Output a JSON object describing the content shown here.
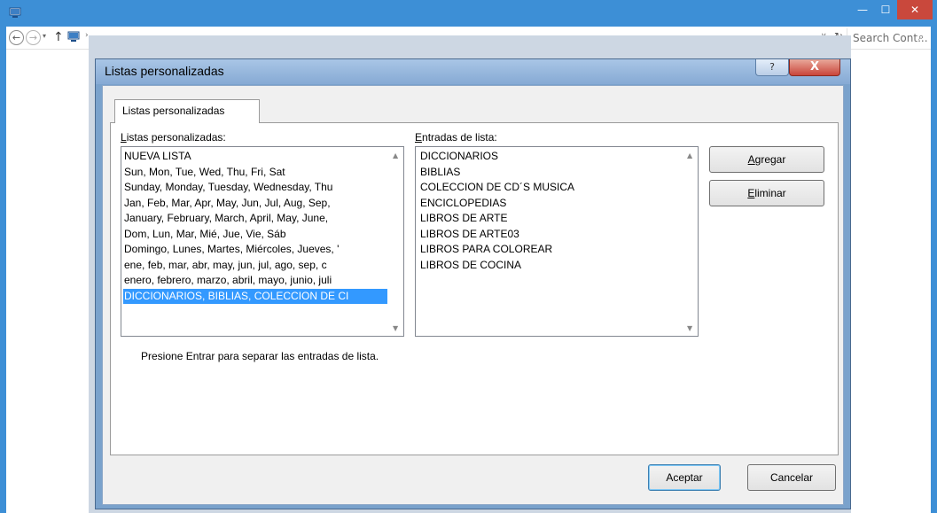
{
  "window": {
    "min_glyph": "—",
    "max_glyph": "☐",
    "close_glyph": "✕"
  },
  "navbar": {
    "back_glyph": "←",
    "forward_glyph": "→",
    "recent_glyph": "▾",
    "up_glyph": "↑",
    "sep_glyph": "›",
    "dropdown_glyph": "∨",
    "refresh_glyph": "↻",
    "search_placeholder": "Search Cont...",
    "search_glyph": "⌕"
  },
  "dialog": {
    "title": "Listas personalizadas",
    "help_glyph": "?",
    "close_glyph": "X",
    "tab_label": "Listas personalizadas",
    "custom_lists_label_first": "L",
    "custom_lists_label_rest": "istas personalizadas:",
    "custom_lists": [
      "NUEVA LISTA",
      "Sun, Mon, Tue, Wed, Thu, Fri, Sat",
      "Sunday, Monday, Tuesday, Wednesday, Thu",
      "Jan, Feb, Mar, Apr, May, Jun, Jul, Aug, Sep,",
      "January, February, March, April, May, June,",
      "Dom, Lun, Mar, Mié, Jue, Vie, Sáb",
      "Domingo, Lunes, Martes, Miércoles, Jueves, '",
      "ene, feb, mar, abr, may, jun, jul, ago, sep, c",
      "enero, febrero, marzo, abril, mayo, junio, juli",
      "DICCIONARIOS, BIBLIAS, COLECCION DE CI"
    ],
    "selected_index": 9,
    "entries_label_first": "E",
    "entries_label_rest": "ntradas de lista:",
    "entries": [
      "DICCIONARIOS",
      "BIBLIAS",
      "COLECCION DE CD´S MUSICA",
      "ENCICLOPEDIAS",
      "LIBROS DE ARTE",
      "LIBROS DE ARTE03",
      "LIBROS PARA COLOREAR",
      "LIBROS DE COCINA"
    ],
    "add_button_first": "A",
    "add_button_rest": "gregar",
    "delete_button_first": "E",
    "delete_button_rest": "liminar",
    "hint": "Presione Entrar para separar las entradas de lista.",
    "ok_button": "Aceptar",
    "cancel_button": "Cancelar",
    "scroll_up_glyph": "▲",
    "scroll_down_glyph": "▼"
  }
}
